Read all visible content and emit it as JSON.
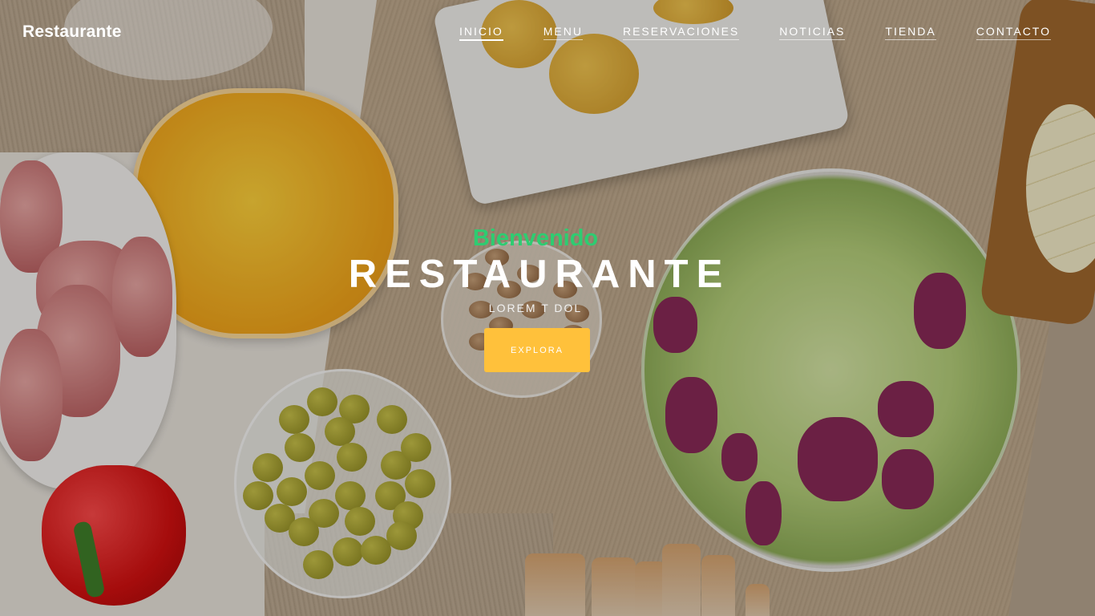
{
  "header": {
    "brand": "Restaurante",
    "nav": [
      {
        "label": "INICIO",
        "active": true
      },
      {
        "label": "MENU",
        "active": false
      },
      {
        "label": "RESERVACIONES",
        "active": false
      },
      {
        "label": "NOTICIAS",
        "active": false
      },
      {
        "label": "TIENDA",
        "active": false
      },
      {
        "label": "CONTACTO",
        "active": false
      }
    ]
  },
  "hero": {
    "welcome": "Bienvenido",
    "title": "RESTAURANTE",
    "subtitle": "LOREM T DOL",
    "cta_label": "EXPLORA"
  },
  "colors": {
    "accent_green": "#2ecc71",
    "cta_yellow": "#ffc13b",
    "text_white": "#ffffff"
  },
  "background": {
    "image": "food-table-photo"
  }
}
